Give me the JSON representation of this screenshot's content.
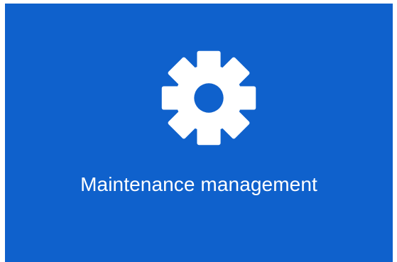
{
  "tile": {
    "icon": "gear-icon",
    "label": "Maintenance management",
    "background_color": "#0f61cc",
    "foreground_color": "#ffffff"
  }
}
